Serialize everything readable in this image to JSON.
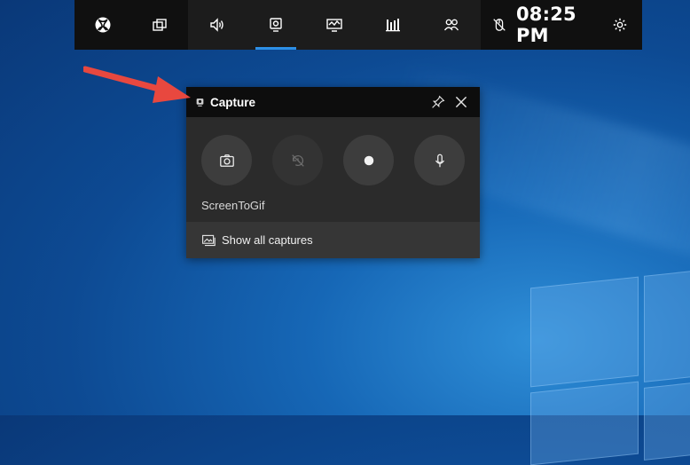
{
  "gamebar": {
    "buttons": [
      {
        "icon": "xbox-icon"
      },
      {
        "icon": "widget-menu-icon"
      },
      {
        "icon": "audio-icon"
      },
      {
        "icon": "capture-icon",
        "active": true
      },
      {
        "icon": "performance-icon"
      },
      {
        "icon": "resources-icon"
      },
      {
        "icon": "social-icon"
      }
    ],
    "clock": "08:25 PM",
    "icons": {
      "mouse": "mouse-off-icon",
      "settings": "gear-icon"
    }
  },
  "capture_widget": {
    "title": "Capture",
    "app_name": "ScreenToGif",
    "show_all_captures": "Show all captures",
    "actions": [
      {
        "icon": "camera-icon",
        "enabled": true
      },
      {
        "icon": "record-last-off-icon",
        "enabled": false
      },
      {
        "icon": "record-dot-icon",
        "enabled": true
      },
      {
        "icon": "microphone-icon",
        "enabled": true
      }
    ]
  },
  "colors": {
    "accent": "#2d8fe6",
    "arrow": "#e8483f",
    "bar_bg": "#1c1c1c",
    "widget_bg": "#2b2b2b"
  }
}
